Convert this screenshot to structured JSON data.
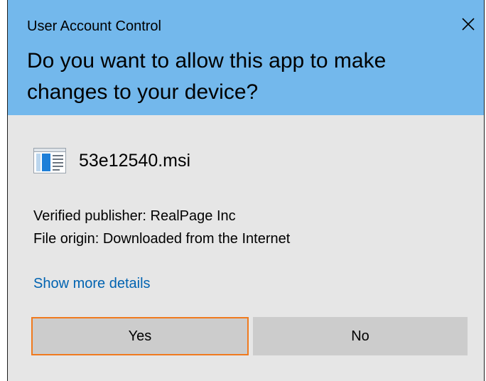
{
  "dialog": {
    "title": "User Account Control",
    "question": "Do you want to allow this app to make changes to your device?",
    "app_name": "53e12540.msi",
    "publisher_line": "Verified publisher: RealPage Inc",
    "origin_line": "File origin: Downloaded from the Internet",
    "details_link": "Show more details",
    "yes_label": "Yes",
    "no_label": "No",
    "icons": {
      "close": "close-icon",
      "app": "installer-app-icon"
    },
    "colors": {
      "header_bg": "#73b8ec",
      "body_bg": "#e6e6e6",
      "button_bg": "#cccccc",
      "focus_border": "#f07a1e",
      "link": "#0063b1"
    }
  }
}
